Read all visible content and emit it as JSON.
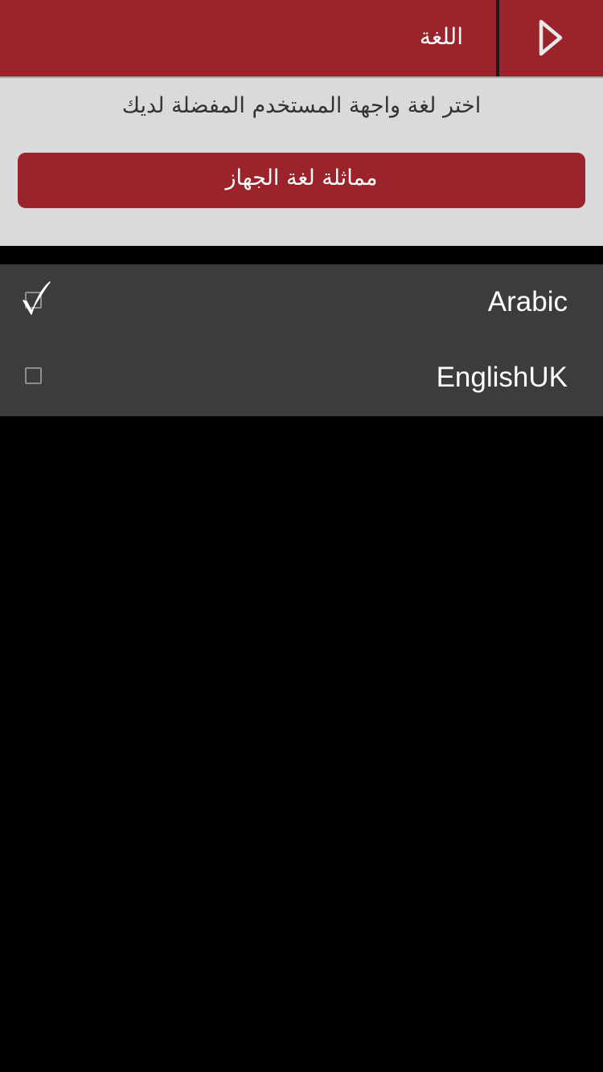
{
  "header": {
    "title": "اللغة",
    "back_icon": "chevron-right-icon",
    "background_color": "#9b232b"
  },
  "settings": {
    "prompt": "اختر لغة واجهة المستخدم المفضلة لديك",
    "match_device_button_label": "مماثلة لغة الجهاز"
  },
  "languages": [
    {
      "label": "Arabic",
      "selected": true
    },
    {
      "label": "EnglishUK",
      "selected": false
    }
  ],
  "colors": {
    "accent": "#9b232b",
    "panel": "#d9dadc",
    "list": "#3c3b3d"
  }
}
